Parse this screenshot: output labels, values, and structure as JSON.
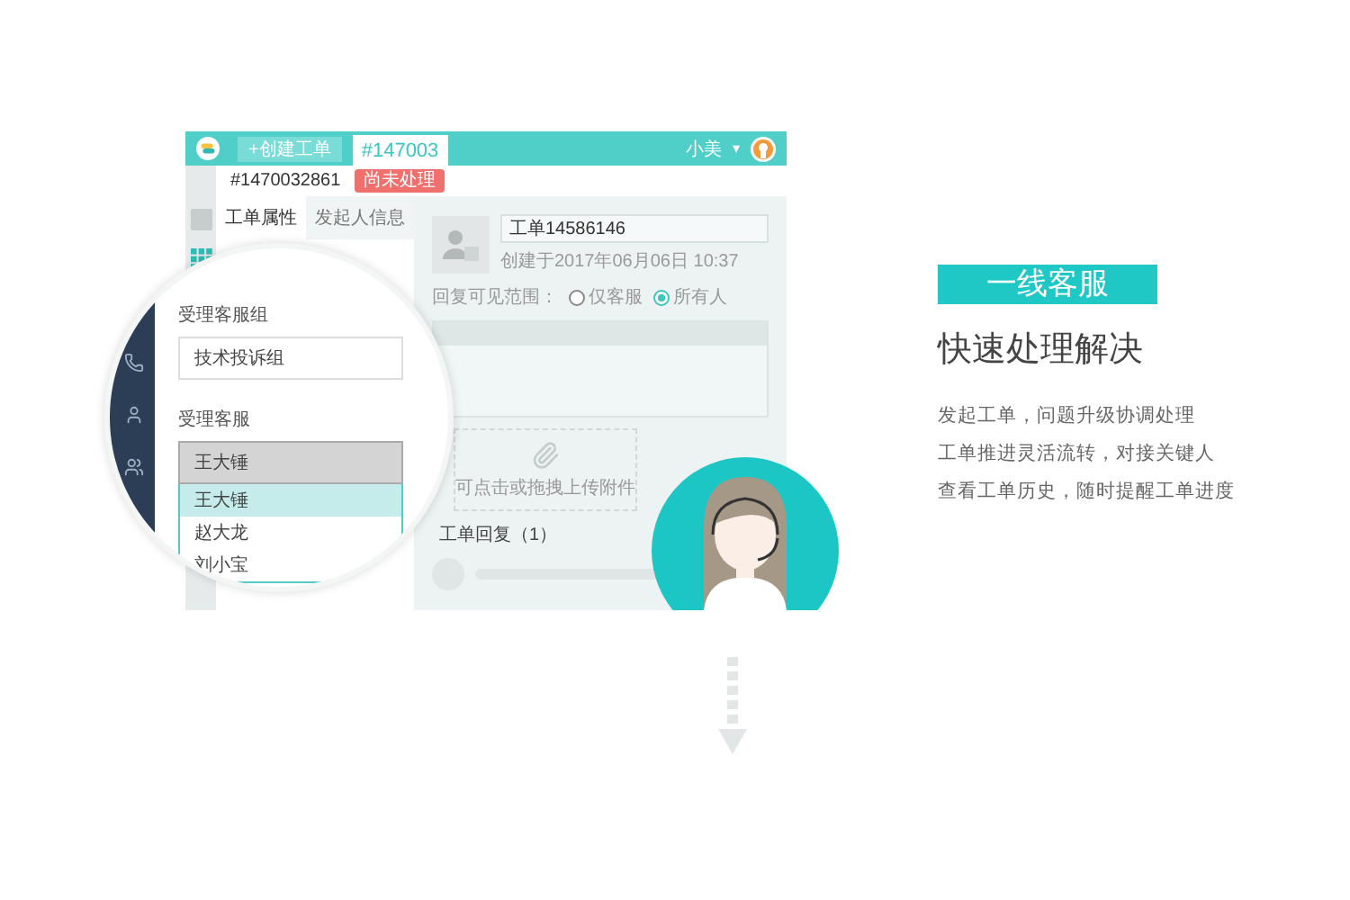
{
  "app": {
    "top_bar": {
      "create_button": "+创建工单",
      "tabs": [
        {
          "label": "#147003",
          "selected": true
        }
      ],
      "user": "小美",
      "caret": "▾"
    },
    "ticket_header": {
      "number": "#1470032861",
      "status": "尚未处理"
    },
    "panel_tabs": [
      {
        "label": "工单属性",
        "selected": true
      },
      {
        "label": "发起人信息",
        "selected": false
      }
    ],
    "ticket": {
      "title": "工单14586146",
      "created": "创建于2017年06月06日 10:37",
      "visibility_label": "回复可见范围：",
      "visibility_options": [
        {
          "label": "仅客服",
          "selected": false
        },
        {
          "label": "所有人",
          "selected": true
        }
      ],
      "upload_hint": "可点击或拖拽上传附件",
      "replies_label": "工单回复（1）"
    }
  },
  "magnifier": {
    "fields": [
      {
        "label": "受理客服组",
        "value": "技术投诉组"
      },
      {
        "label": "受理客服",
        "value": "王大锤"
      }
    ],
    "options": [
      {
        "label": "王大锤",
        "selected": true
      },
      {
        "label": "赵大龙",
        "selected": false
      },
      {
        "label": "刘小宝",
        "selected": false
      }
    ]
  },
  "feature": {
    "badge": "一线客服",
    "heading": "快速处理解决",
    "lines": [
      "发起工单，问题升级协调处理",
      "工单推进灵活流转，对接关键人",
      "查看工单历史，随时提醒工单进度"
    ]
  }
}
